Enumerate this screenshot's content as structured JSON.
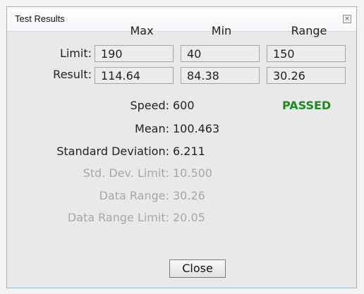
{
  "window": {
    "title": "Test Results"
  },
  "columns": [
    "Max",
    "Min",
    "Range"
  ],
  "rows": [
    {
      "label": "Limit:",
      "values": [
        "190",
        "40",
        "150"
      ]
    },
    {
      "label": "Result:",
      "values": [
        "114.64",
        "84.38",
        "30.26"
      ]
    }
  ],
  "status": {
    "text": "PASSED",
    "color": "#1f8a1f"
  },
  "stats": [
    {
      "label": "Speed:",
      "value": "600",
      "enabled": true
    },
    {
      "label": "Mean:",
      "value": "100.463",
      "enabled": true
    },
    {
      "label": "Standard Deviation:",
      "value": "6.211",
      "enabled": true
    },
    {
      "label": "Std. Dev. Limit:",
      "value": "10.500",
      "enabled": false
    },
    {
      "label": "Data Range:",
      "value": "30.26",
      "enabled": false
    },
    {
      "label": "Data Range Limit:",
      "value": "20.05",
      "enabled": false
    }
  ],
  "buttons": {
    "close": "Close"
  }
}
